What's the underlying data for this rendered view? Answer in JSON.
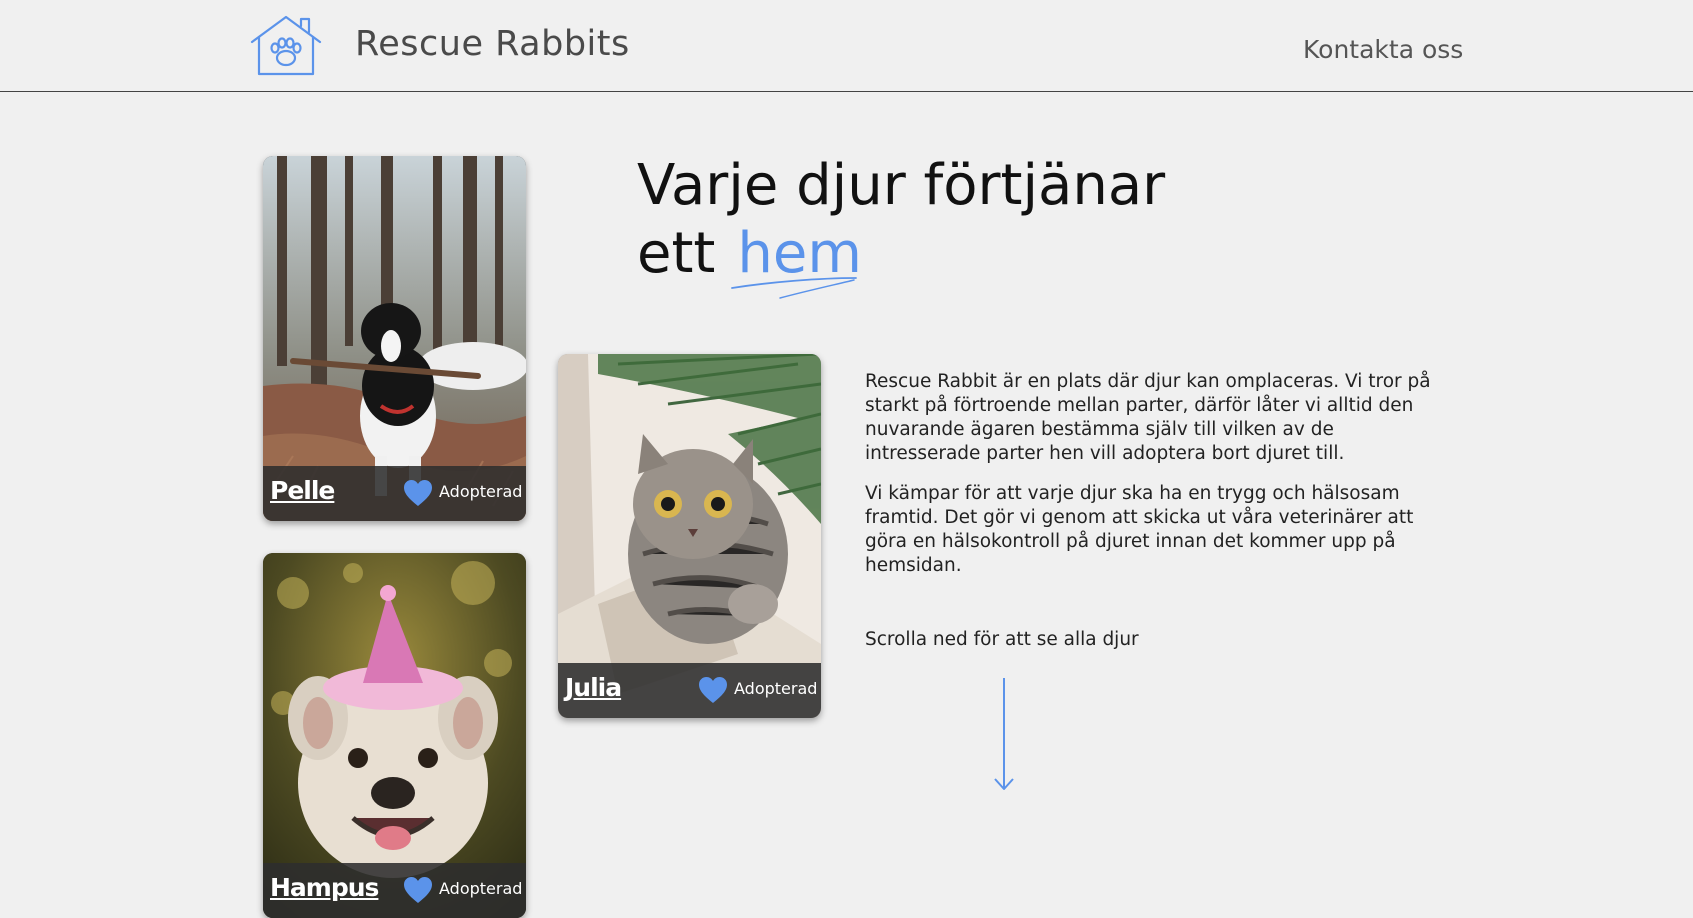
{
  "header": {
    "brand": "Rescue Rabbits",
    "contact_link": "Kontakta oss"
  },
  "hero": {
    "headline_line1": "Varje djur förtjänar",
    "headline_line2_prefix": "ett",
    "headline_accent": "hem"
  },
  "intro": {
    "paragraph1": "Rescue Rabbit är en plats där djur kan omplaceras. Vi tror på starkt på förtroende mellan parter, därför låter vi alltid den nuvarande ägaren bestämma själv till vilken av de intresserade parter hen vill adoptera bort djuret till.",
    "paragraph2": "Vi kämpar för att varje djur ska ha en trygg och hälsosam framtid. Det gör vi genom att skicka ut våra veterinärer att göra en hälsokontroll på djuret innan det kommer upp på hemsidan.",
    "scroll_hint": "Scrolla ned för att se alla djur"
  },
  "animals": [
    {
      "name": "Pelle",
      "status": "Adopterad"
    },
    {
      "name": "Julia",
      "status": "Adopterad"
    },
    {
      "name": "Hampus",
      "status": "Adopterad"
    }
  ],
  "colors": {
    "accent": "#5b93ea",
    "background": "#f0f0f0",
    "card_bar": "#2d2d2d"
  },
  "icons": {
    "logo": "house-paw-icon",
    "status": "heart-icon",
    "scroll": "arrow-down-icon"
  }
}
